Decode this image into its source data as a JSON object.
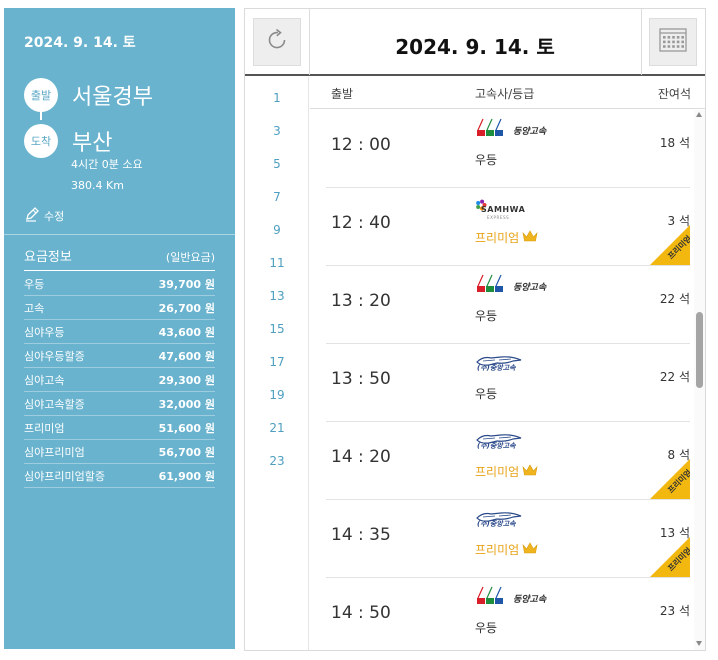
{
  "left": {
    "date": "2024. 9. 14. 토",
    "dep_badge": "출발",
    "dep_name": "서울경부",
    "arr_badge": "도착",
    "arr_name": "부산",
    "duration": "4시간 0분 소요",
    "distance": "380.4 Km",
    "edit_label": "수정",
    "fare_title": "요금정보",
    "fare_sub": "(일반요금)",
    "fares": [
      {
        "name": "우등",
        "price": "39,700 원"
      },
      {
        "name": "고속",
        "price": "26,700 원"
      },
      {
        "name": "심야우등",
        "price": "43,600 원"
      },
      {
        "name": "심야우등할증",
        "price": "47,600 원"
      },
      {
        "name": "심야고속",
        "price": "29,300 원"
      },
      {
        "name": "심야고속할증",
        "price": "32,000 원"
      },
      {
        "name": "프리미엄",
        "price": "51,600 원"
      },
      {
        "name": "심야프리미엄",
        "price": "56,700 원"
      },
      {
        "name": "심야프리미엄할증",
        "price": "61,900 원"
      }
    ]
  },
  "header": {
    "date": "2024. 9. 14. 토"
  },
  "hours": [
    "1",
    "3",
    "5",
    "7",
    "9",
    "11",
    "13",
    "15",
    "17",
    "19",
    "21",
    "23"
  ],
  "columns": {
    "departure": "출발",
    "company": "고속사/등급",
    "seats": "잔여석"
  },
  "schedule": [
    {
      "time": "12 : 00",
      "logo": "dongyang",
      "grade": "우등",
      "premium": false,
      "seats": "18 석"
    },
    {
      "time": "12 : 40",
      "logo": "samhwa",
      "grade": "프리미엄",
      "premium": true,
      "seats": "3 석"
    },
    {
      "time": "13 : 20",
      "logo": "dongyang",
      "grade": "우등",
      "premium": false,
      "seats": "22 석"
    },
    {
      "time": "13 : 50",
      "logo": "jungang",
      "grade": "우등",
      "premium": false,
      "seats": "22 석"
    },
    {
      "time": "14 : 20",
      "logo": "jungang",
      "grade": "프리미엄",
      "premium": true,
      "seats": "8 석"
    },
    {
      "time": "14 : 35",
      "logo": "jungang",
      "grade": "프리미엄",
      "premium": true,
      "seats": "13 석"
    },
    {
      "time": "14 : 50",
      "logo": "dongyang",
      "grade": "우등",
      "premium": false,
      "seats": "23 석"
    }
  ],
  "logos": {
    "dongyang": "동양고속",
    "samhwa": "SAMHWA",
    "samhwa_sub": "EXPRESS",
    "jungang": "(주)중앙고속"
  },
  "premium_ribbon": "프리미엄",
  "colors": {
    "panel": "#69b3ce",
    "hour_link": "#4e9fc0",
    "premium": "#e8a318",
    "ribbon": "#f3b80f"
  },
  "icons": {
    "refresh": "refresh-icon",
    "calendar": "calendar-icon",
    "edit": "pen-icon",
    "crown": "crown-icon"
  }
}
